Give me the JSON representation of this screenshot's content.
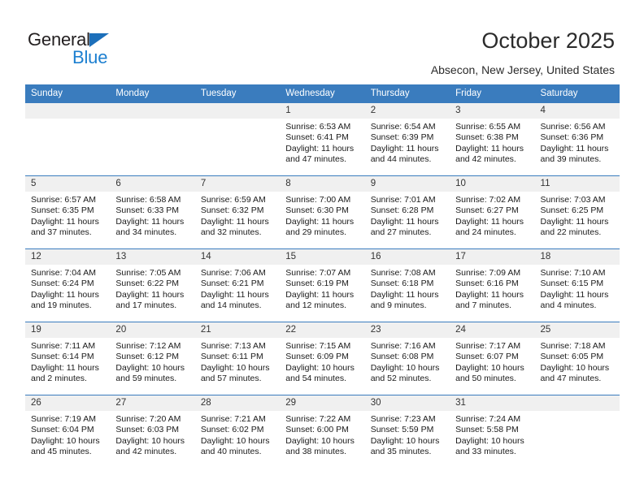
{
  "brand": {
    "name_top": "General",
    "name_bottom": "Blue",
    "accent_color": "#1c7fd0",
    "triangle_color": "#1c6fba"
  },
  "header": {
    "title": "October 2025",
    "location": "Absecon, New Jersey, United States"
  },
  "theme": {
    "header_row_bg": "#3a7cbe",
    "date_band_bg": "#f0f0f0",
    "grid_line": "#3a7cbe"
  },
  "weekday_headers": [
    "Sunday",
    "Monday",
    "Tuesday",
    "Wednesday",
    "Thursday",
    "Friday",
    "Saturday"
  ],
  "labels": {
    "sunrise_prefix": "Sunrise:",
    "sunset_prefix": "Sunset:",
    "daylight_prefix": "Daylight:"
  },
  "weeks": [
    [
      {
        "date": "",
        "empty": true,
        "l1": "",
        "l2": "",
        "l3": "",
        "l4": ""
      },
      {
        "date": "",
        "empty": true,
        "l1": "",
        "l2": "",
        "l3": "",
        "l4": ""
      },
      {
        "date": "",
        "empty": true,
        "l1": "",
        "l2": "",
        "l3": "",
        "l4": ""
      },
      {
        "date": "1",
        "empty": false,
        "l1": "Sunrise: 6:53 AM",
        "l2": "Sunset: 6:41 PM",
        "l3": "Daylight: 11 hours",
        "l4": "and 47 minutes."
      },
      {
        "date": "2",
        "empty": false,
        "l1": "Sunrise: 6:54 AM",
        "l2": "Sunset: 6:39 PM",
        "l3": "Daylight: 11 hours",
        "l4": "and 44 minutes."
      },
      {
        "date": "3",
        "empty": false,
        "l1": "Sunrise: 6:55 AM",
        "l2": "Sunset: 6:38 PM",
        "l3": "Daylight: 11 hours",
        "l4": "and 42 minutes."
      },
      {
        "date": "4",
        "empty": false,
        "l1": "Sunrise: 6:56 AM",
        "l2": "Sunset: 6:36 PM",
        "l3": "Daylight: 11 hours",
        "l4": "and 39 minutes."
      }
    ],
    [
      {
        "date": "5",
        "empty": false,
        "l1": "Sunrise: 6:57 AM",
        "l2": "Sunset: 6:35 PM",
        "l3": "Daylight: 11 hours",
        "l4": "and 37 minutes."
      },
      {
        "date": "6",
        "empty": false,
        "l1": "Sunrise: 6:58 AM",
        "l2": "Sunset: 6:33 PM",
        "l3": "Daylight: 11 hours",
        "l4": "and 34 minutes."
      },
      {
        "date": "7",
        "empty": false,
        "l1": "Sunrise: 6:59 AM",
        "l2": "Sunset: 6:32 PM",
        "l3": "Daylight: 11 hours",
        "l4": "and 32 minutes."
      },
      {
        "date": "8",
        "empty": false,
        "l1": "Sunrise: 7:00 AM",
        "l2": "Sunset: 6:30 PM",
        "l3": "Daylight: 11 hours",
        "l4": "and 29 minutes."
      },
      {
        "date": "9",
        "empty": false,
        "l1": "Sunrise: 7:01 AM",
        "l2": "Sunset: 6:28 PM",
        "l3": "Daylight: 11 hours",
        "l4": "and 27 minutes."
      },
      {
        "date": "10",
        "empty": false,
        "l1": "Sunrise: 7:02 AM",
        "l2": "Sunset: 6:27 PM",
        "l3": "Daylight: 11 hours",
        "l4": "and 24 minutes."
      },
      {
        "date": "11",
        "empty": false,
        "l1": "Sunrise: 7:03 AM",
        "l2": "Sunset: 6:25 PM",
        "l3": "Daylight: 11 hours",
        "l4": "and 22 minutes."
      }
    ],
    [
      {
        "date": "12",
        "empty": false,
        "l1": "Sunrise: 7:04 AM",
        "l2": "Sunset: 6:24 PM",
        "l3": "Daylight: 11 hours",
        "l4": "and 19 minutes."
      },
      {
        "date": "13",
        "empty": false,
        "l1": "Sunrise: 7:05 AM",
        "l2": "Sunset: 6:22 PM",
        "l3": "Daylight: 11 hours",
        "l4": "and 17 minutes."
      },
      {
        "date": "14",
        "empty": false,
        "l1": "Sunrise: 7:06 AM",
        "l2": "Sunset: 6:21 PM",
        "l3": "Daylight: 11 hours",
        "l4": "and 14 minutes."
      },
      {
        "date": "15",
        "empty": false,
        "l1": "Sunrise: 7:07 AM",
        "l2": "Sunset: 6:19 PM",
        "l3": "Daylight: 11 hours",
        "l4": "and 12 minutes."
      },
      {
        "date": "16",
        "empty": false,
        "l1": "Sunrise: 7:08 AM",
        "l2": "Sunset: 6:18 PM",
        "l3": "Daylight: 11 hours",
        "l4": "and 9 minutes."
      },
      {
        "date": "17",
        "empty": false,
        "l1": "Sunrise: 7:09 AM",
        "l2": "Sunset: 6:16 PM",
        "l3": "Daylight: 11 hours",
        "l4": "and 7 minutes."
      },
      {
        "date": "18",
        "empty": false,
        "l1": "Sunrise: 7:10 AM",
        "l2": "Sunset: 6:15 PM",
        "l3": "Daylight: 11 hours",
        "l4": "and 4 minutes."
      }
    ],
    [
      {
        "date": "19",
        "empty": false,
        "l1": "Sunrise: 7:11 AM",
        "l2": "Sunset: 6:14 PM",
        "l3": "Daylight: 11 hours",
        "l4": "and 2 minutes."
      },
      {
        "date": "20",
        "empty": false,
        "l1": "Sunrise: 7:12 AM",
        "l2": "Sunset: 6:12 PM",
        "l3": "Daylight: 10 hours",
        "l4": "and 59 minutes."
      },
      {
        "date": "21",
        "empty": false,
        "l1": "Sunrise: 7:13 AM",
        "l2": "Sunset: 6:11 PM",
        "l3": "Daylight: 10 hours",
        "l4": "and 57 minutes."
      },
      {
        "date": "22",
        "empty": false,
        "l1": "Sunrise: 7:15 AM",
        "l2": "Sunset: 6:09 PM",
        "l3": "Daylight: 10 hours",
        "l4": "and 54 minutes."
      },
      {
        "date": "23",
        "empty": false,
        "l1": "Sunrise: 7:16 AM",
        "l2": "Sunset: 6:08 PM",
        "l3": "Daylight: 10 hours",
        "l4": "and 52 minutes."
      },
      {
        "date": "24",
        "empty": false,
        "l1": "Sunrise: 7:17 AM",
        "l2": "Sunset: 6:07 PM",
        "l3": "Daylight: 10 hours",
        "l4": "and 50 minutes."
      },
      {
        "date": "25",
        "empty": false,
        "l1": "Sunrise: 7:18 AM",
        "l2": "Sunset: 6:05 PM",
        "l3": "Daylight: 10 hours",
        "l4": "and 47 minutes."
      }
    ],
    [
      {
        "date": "26",
        "empty": false,
        "l1": "Sunrise: 7:19 AM",
        "l2": "Sunset: 6:04 PM",
        "l3": "Daylight: 10 hours",
        "l4": "and 45 minutes."
      },
      {
        "date": "27",
        "empty": false,
        "l1": "Sunrise: 7:20 AM",
        "l2": "Sunset: 6:03 PM",
        "l3": "Daylight: 10 hours",
        "l4": "and 42 minutes."
      },
      {
        "date": "28",
        "empty": false,
        "l1": "Sunrise: 7:21 AM",
        "l2": "Sunset: 6:02 PM",
        "l3": "Daylight: 10 hours",
        "l4": "and 40 minutes."
      },
      {
        "date": "29",
        "empty": false,
        "l1": "Sunrise: 7:22 AM",
        "l2": "Sunset: 6:00 PM",
        "l3": "Daylight: 10 hours",
        "l4": "and 38 minutes."
      },
      {
        "date": "30",
        "empty": false,
        "l1": "Sunrise: 7:23 AM",
        "l2": "Sunset: 5:59 PM",
        "l3": "Daylight: 10 hours",
        "l4": "and 35 minutes."
      },
      {
        "date": "31",
        "empty": false,
        "l1": "Sunrise: 7:24 AM",
        "l2": "Sunset: 5:58 PM",
        "l3": "Daylight: 10 hours",
        "l4": "and 33 minutes."
      },
      {
        "date": "",
        "empty": true,
        "l1": "",
        "l2": "",
        "l3": "",
        "l4": ""
      }
    ]
  ]
}
